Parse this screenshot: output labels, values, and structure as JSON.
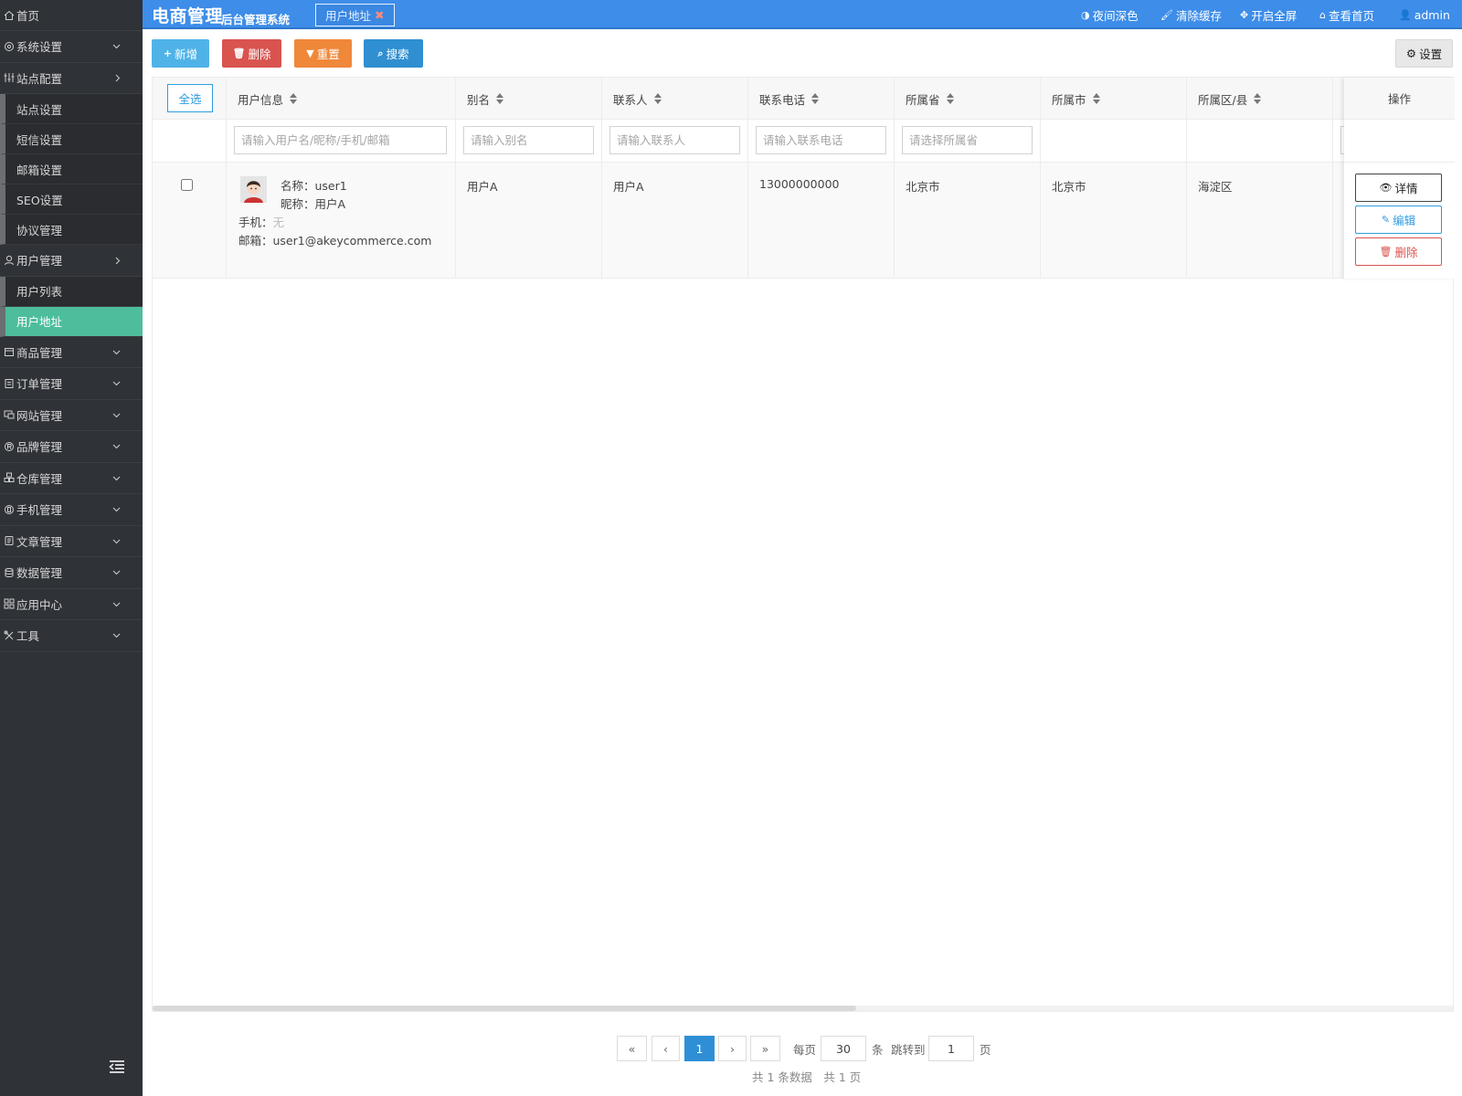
{
  "colors": {
    "sidebar_bg": "#2f3237",
    "active_item": "#4ebd9c",
    "header_bg": "#3d8de9",
    "btn_add": "#4fb3e8",
    "btn_delete": "#d9534f",
    "btn_reset": "#f0883a",
    "btn_search": "#2f8fd1",
    "link_blue": "#2e9de0"
  },
  "sidebar": {
    "home": "首页",
    "groups": [
      {
        "label": "系统设置",
        "icon": "gear-icon"
      },
      {
        "label": "站点配置",
        "icon": "sliders-icon"
      },
      {
        "label": "用户管理",
        "icon": "user-icon"
      },
      {
        "label": "商品管理",
        "icon": "box-icon"
      },
      {
        "label": "订单管理",
        "icon": "order-icon"
      },
      {
        "label": "网站管理",
        "icon": "website-icon"
      },
      {
        "label": "品牌管理",
        "icon": "brand-icon"
      },
      {
        "label": "仓库管理",
        "icon": "warehouse-icon"
      },
      {
        "label": "手机管理",
        "icon": "mobile-icon"
      },
      {
        "label": "文章管理",
        "icon": "article-icon"
      },
      {
        "label": "数据管理",
        "icon": "database-icon"
      },
      {
        "label": "应用中心",
        "icon": "apps-icon"
      },
      {
        "label": "工具",
        "icon": "tools-icon"
      }
    ],
    "site_config_items": [
      "站点设置",
      "短信设置",
      "邮箱设置",
      "SEO设置",
      "协议管理"
    ],
    "user_items": [
      "用户列表",
      "用户地址"
    ]
  },
  "header": {
    "title": "电商管理",
    "subtitle": "后台管理系统",
    "tab_label": "用户地址",
    "links": {
      "night_mode": "夜间深色",
      "clear_cache": "清除缓存",
      "fullscreen": "开启全屏",
      "view_home": "查看首页",
      "user": "admin"
    }
  },
  "toolbar": {
    "add": "新增",
    "delete": "删除",
    "reset": "重置",
    "search": "搜索",
    "settings": "设置"
  },
  "table": {
    "select_all": "全选",
    "columns": [
      "用户信息",
      "别名",
      "联系人",
      "联系电话",
      "所属省",
      "所属市",
      "所属区/县"
    ],
    "operation_header": "操作",
    "filters": {
      "user_info": "请输入用户名/昵称/手机/邮箱",
      "alias": "请输入别名",
      "contact": "请输入联系人",
      "phone": "请输入联系电话",
      "province": "请选择所属省"
    },
    "rows": [
      {
        "name": "名称：user1",
        "nickname": "昵称：用户A",
        "mobile_label": "手机：",
        "mobile_value": "无",
        "email": "邮箱：user1@akeycommerce.com",
        "alias": "用户A",
        "contact": "用户A",
        "phone": "13000000000",
        "province": "北京市",
        "city": "北京市",
        "district": "海淀区"
      }
    ],
    "row_actions": {
      "detail": "详情",
      "edit": "编辑",
      "delete": "删除"
    }
  },
  "pagination": {
    "first": "«",
    "prev": "‹",
    "current": "1",
    "next": "›",
    "last": "»",
    "per_page_label": "每页",
    "per_page_value": "30",
    "per_page_unit": "条",
    "jump_label": "跳转到",
    "jump_value": "1",
    "jump_unit": "页",
    "summary": "共 1 条数据　共 1 页"
  }
}
